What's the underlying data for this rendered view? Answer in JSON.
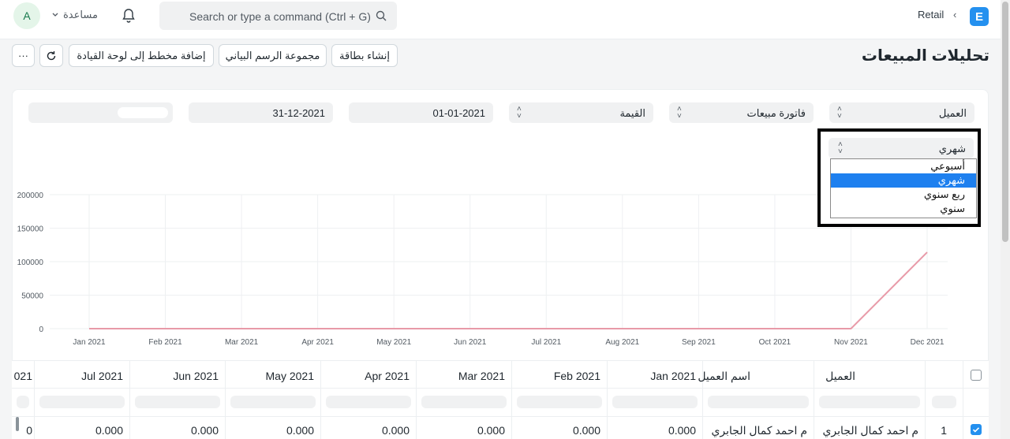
{
  "topbar": {
    "avatar_initial": "A",
    "help_label": "مساعدة",
    "search_placeholder": "Search or type a command (Ctrl + G)",
    "breadcrumb": "Retail",
    "breadcrumb_separator": "‹",
    "logo_letter": "E"
  },
  "page": {
    "title": "تحليلات المبيعات"
  },
  "toolbar": {
    "create_card": "إنشاء بطاقة",
    "chart_group": "مجموعة الرسم البياني",
    "add_to_dashboard": "إضافة مخطط إلى لوحة القيادة",
    "more": "···"
  },
  "filters": {
    "tree_type": "العميل",
    "doc_type": "فاتورة مبيعات",
    "value_type": "القيمة",
    "from_date": "01-01-2021",
    "to_date": "31-12-2021"
  },
  "period": {
    "selected": "شهري",
    "options": [
      "أسبوعي",
      "شهري",
      "ربع سنوي",
      "سنوي"
    ],
    "active_index": 1
  },
  "chart_data": {
    "type": "line",
    "categories": [
      "Jan 2021",
      "Feb 2021",
      "Mar 2021",
      "Apr 2021",
      "May 2021",
      "Jun 2021",
      "Jul 2021",
      "Aug 2021",
      "Sep 2021",
      "Oct 2021",
      "Nov 2021",
      "Dec 2021"
    ],
    "y_ticks": [
      "200000",
      "150000",
      "100000",
      "50000",
      "0"
    ],
    "ylim": [
      0,
      200000
    ],
    "series": [
      {
        "values": [
          0,
          0,
          0,
          0,
          0,
          0,
          0,
          0,
          0,
          0,
          0,
          114000
        ],
        "color": "#e89aa8"
      }
    ],
    "grid": true
  },
  "table": {
    "headers": {
      "customer": "العميل",
      "customer_name": "اسم العميل",
      "jan": "Jan 2021",
      "feb": "Feb 2021",
      "mar": "Mar 2021",
      "apr": "Apr 2021",
      "may": "May 2021",
      "jun": "Jun 2021",
      "jul": "Jul 2021",
      "partial": "021"
    },
    "row": {
      "index": "1",
      "customer": "م احمد كمال الجابري",
      "customer_name": "م احمد كمال الجابري",
      "jan": "0.000",
      "feb": "0.000",
      "mar": "0.000",
      "apr": "0.000",
      "may": "0.000",
      "jun": "0.000",
      "jul": "0.000",
      "partial": "0"
    }
  }
}
